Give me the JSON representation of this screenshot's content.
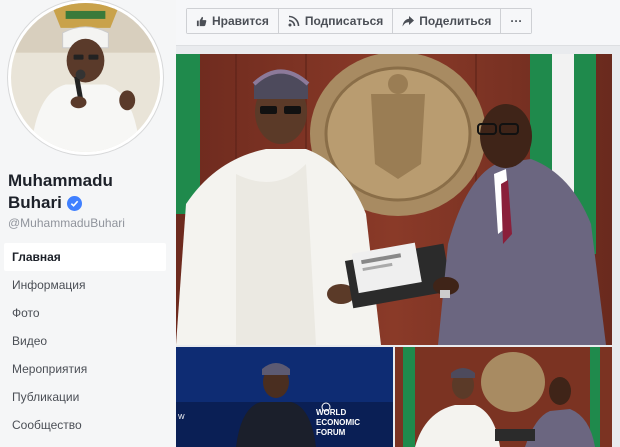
{
  "profile": {
    "name_line1": "Muhammadu",
    "name_line2": "Buhari",
    "handle": "@MuhammaduBuhari"
  },
  "nav": {
    "items": [
      {
        "label": "Главная",
        "active": true
      },
      {
        "label": "Информация"
      },
      {
        "label": "Фото"
      },
      {
        "label": "Видео"
      },
      {
        "label": "Мероприятия"
      },
      {
        "label": "Публикации"
      },
      {
        "label": "Сообщество"
      }
    ]
  },
  "actions": {
    "like_label": "Нравится",
    "follow_label": "Подписаться",
    "share_label": "Поделиться",
    "more_label": "···"
  },
  "thumb_text": {
    "wef_line1": "WORLD",
    "wef_line2": "ECONOMIC",
    "wef_line3": "FORUM"
  },
  "colors": {
    "verified": "#4080ff",
    "nav_active_bg": "#ffffff",
    "page_bg": "#e9ebee"
  }
}
